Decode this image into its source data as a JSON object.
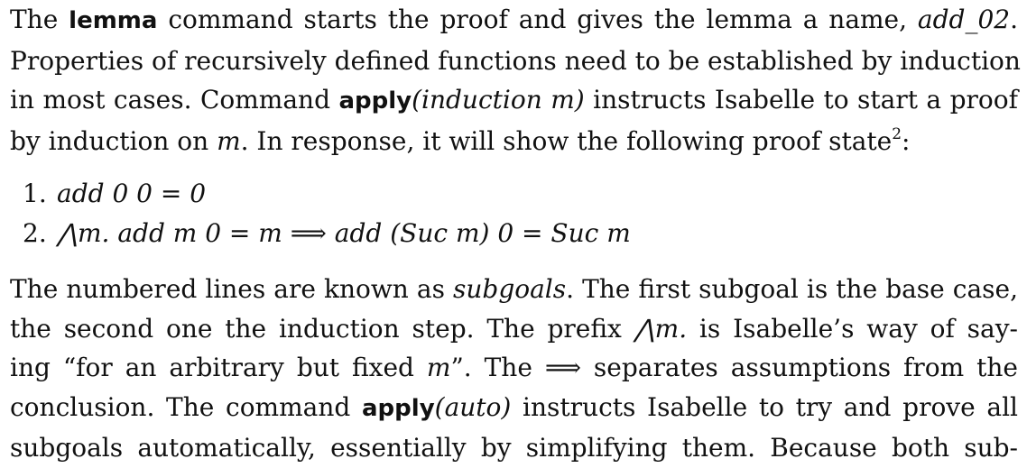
{
  "paragraph1": {
    "l1_a": "The ",
    "l1_kw": "lemma",
    "l1_b": " command starts the proof and gives the lemma a name, ",
    "l1_name": "add_02",
    "l1_c": ".",
    "l2": "Properties of recursively defined functions need to be established by induction",
    "l3_a": "in most cases. Command ",
    "l3_kw": "apply",
    "l3_arg": "(induction m)",
    "l3_b": " instructs Isabelle to start a proof",
    "l4_a": "by induction on ",
    "l4_m": "m",
    "l4_b": ". In response, it will show the following proof state",
    "l4_sup": "2",
    "l4_c": ":"
  },
  "subgoals": [
    {
      "num": "1.",
      "text": "add 0 0 = 0"
    },
    {
      "num": "2.",
      "text": "⋀m. add m 0 = m ⟹ add (Suc m) 0 = Suc m"
    }
  ],
  "paragraph2": {
    "l1_a": "The numbered lines are known as ",
    "l1_em": "subgoals",
    "l1_b": ". The first subgoal is the base case,",
    "l2_a": "the second one the induction step. The prefix ",
    "l2_sym": "⋀m.",
    "l2_b": " is Isabelle’s way of say-",
    "l3_a": "ing “for an arbitrary but fixed ",
    "l3_m": "m",
    "l3_b": "”. The ",
    "l3_sym": "⟹",
    "l3_c": " separates assumptions from the",
    "l4_a": "conclusion. The command ",
    "l4_kw": "apply",
    "l4_arg": "(auto)",
    "l4_b": " instructs Isabelle to try and prove all",
    "l5": "subgoals automatically, essentially by simplifying them. Because both sub-"
  }
}
